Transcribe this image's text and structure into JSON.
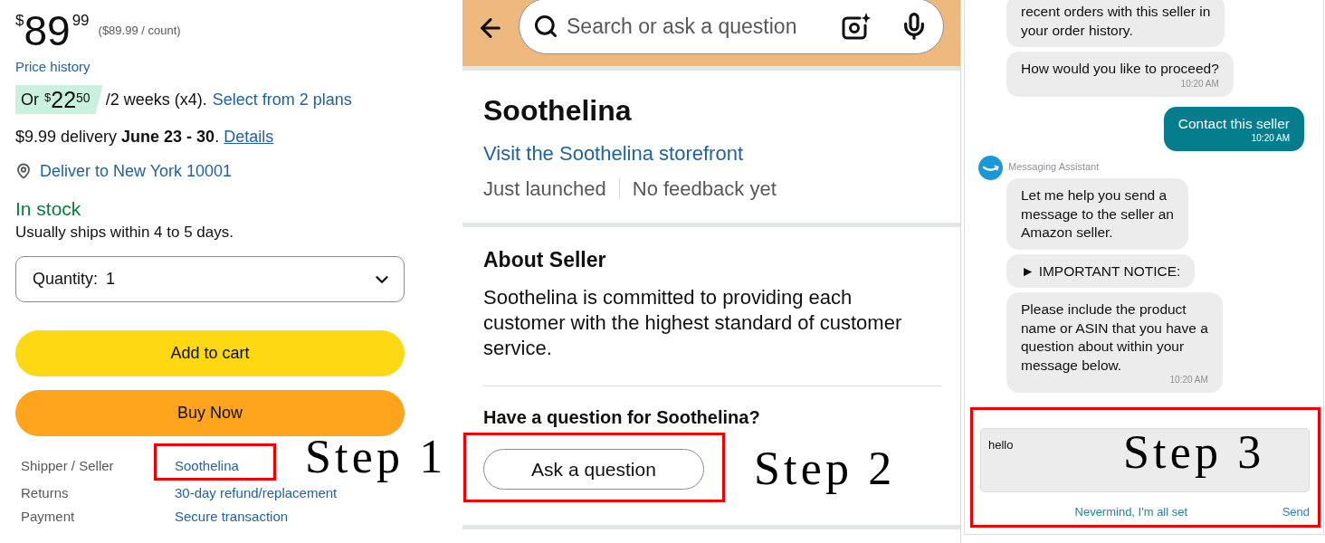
{
  "product_panel": {
    "price": {
      "currency": "$",
      "whole": "89",
      "fraction": "99",
      "unit_price": "($89.99 / count)"
    },
    "price_history_link": "Price history",
    "installment": {
      "prefix": "Or",
      "currency": "$",
      "whole": "22",
      "fraction": "50",
      "terms": "/2 weeks (x4).",
      "plans_link": "Select from 2 plans"
    },
    "delivery": {
      "text": "$9.99 delivery **June 23 - 30**.",
      "details_link": "Details"
    },
    "deliver_to_link": "Deliver to New York 10001",
    "availability": "In stock",
    "shipping_note": "Usually ships within 4 to 5 days.",
    "quantity": {
      "label": "Quantity:",
      "value": "1"
    },
    "buttons": [
      {
        "kind": "cart",
        "label": "Add to cart"
      },
      {
        "kind": "buy",
        "label": "Buy Now"
      }
    ],
    "details": [
      {
        "label": "Shipper / Seller",
        "value": "Soothelina",
        "highlighted": true
      },
      {
        "label": "Returns",
        "value": "30-day refund/replacement",
        "highlighted": false
      },
      {
        "label": "Payment",
        "value": "Secure transaction",
        "highlighted": false
      }
    ],
    "annotation": "Step 1"
  },
  "seller_panel": {
    "search": {
      "placeholder": "Search or ask a question"
    },
    "seller_name": "Soothelina",
    "storefront_link": "Visit the Soothelina storefront",
    "stats": [
      "Just launched",
      "No feedback yet"
    ],
    "about": {
      "heading": "About Seller",
      "text": "Soothelina is committed to providing each customer with the highest standard of customer service."
    },
    "question": {
      "heading": "Have a question for Soothelina?",
      "button": "Ask a question",
      "highlighted": true
    },
    "annotation": "Step 2"
  },
  "chat_panel": {
    "messages": [
      {
        "kind": "received",
        "text": "recent orders with this seller in\nyour order history."
      },
      {
        "kind": "received",
        "text": "How would you like to proceed?",
        "time": "10:20 AM"
      },
      {
        "kind": "sent",
        "text": "Contact this seller",
        "time": "10:20 AM"
      },
      {
        "kind": "sender",
        "name": "Messaging Assistant"
      },
      {
        "kind": "received",
        "text": "Let me help you send a\nmessage to the seller an\nAmazon seller."
      },
      {
        "kind": "received",
        "text": "► IMPORTANT NOTICE:"
      },
      {
        "kind": "received",
        "text": "Please include the product\nname or ASIN that you have a\nquestion about within your\nmessage below.",
        "time": "10:20 AM"
      }
    ],
    "composer": {
      "value": "hello",
      "highlighted": true,
      "annotation": "Step 3",
      "cancel_link": "Nevermind, I'm all set",
      "send_link": "Send"
    }
  }
}
